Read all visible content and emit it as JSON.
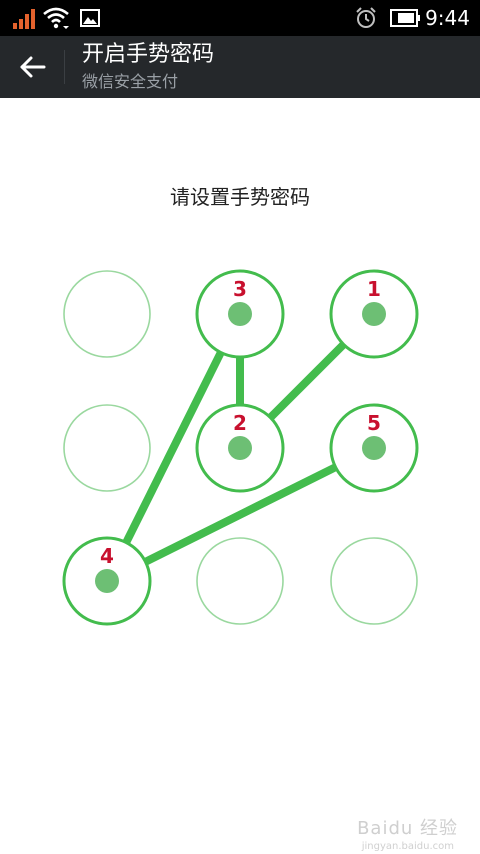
{
  "status_bar": {
    "time": "9:44",
    "icons": [
      "signal-icon",
      "wifi-icon",
      "image-notification-icon",
      "alarm-icon",
      "battery-icon"
    ]
  },
  "action_bar": {
    "title": "开启手势密码",
    "subtitle": "微信安全支付",
    "back_icon": "back-arrow-icon"
  },
  "prompt": "请设置手势密码",
  "pattern": {
    "selected_order": [
      {
        "label": "1",
        "row": 0,
        "col": 2
      },
      {
        "label": "2",
        "row": 1,
        "col": 1
      },
      {
        "label": "3",
        "row": 0,
        "col": 1
      },
      {
        "label": "4",
        "row": 2,
        "col": 0
      },
      {
        "label": "5",
        "row": 1,
        "col": 2
      }
    ],
    "active_color": "#43bc4d",
    "idle_color": "#9ad89f",
    "dot_color": "#6dbf74",
    "number_color": "#c8102e"
  },
  "watermark": {
    "text": "Baidu 经验",
    "sub": "jingyan.baidu.com"
  }
}
